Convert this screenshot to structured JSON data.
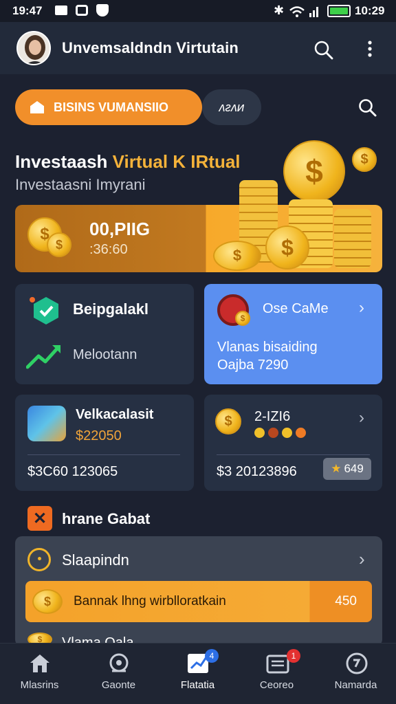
{
  "status_bar": {
    "time_left": "19:47",
    "time_right": "10:29"
  },
  "app_bar": {
    "title": "Unvemsaldndn Virtutain",
    "search_icon": "search-icon",
    "menu_icon": "more-vert-icon"
  },
  "chips": {
    "primary_label": "BISINS VUMANSIIO",
    "secondary_label": "ᴧᴤᴧᴎ"
  },
  "hero": {
    "title_white": "Investaash",
    "title_gold": "Virtual K IRtual",
    "subtitle": "Investaasni Imyrani"
  },
  "balance": {
    "amount": "00,PIIG",
    "sub": ":36:60"
  },
  "cards": {
    "top_left": {
      "title": "Beipgalakl",
      "subtitle": "Melootann"
    },
    "top_right": {
      "title": "Ose CaMe",
      "line1": "Vlanas bisaiding",
      "line2": "Oajba 7290"
    },
    "mid_left": {
      "title": "Velkacalasit",
      "price": "$22050",
      "footer": "$3C60 123065"
    },
    "mid_right": {
      "title": "2-IZI6",
      "footer": "$3 20123896",
      "rating": "649"
    }
  },
  "section": {
    "title": "hrane Gabat",
    "item_title": "Slaapindn",
    "promo_text": "Bannak lhng wirblloratkain",
    "promo_value": "450",
    "item2_title": "Vlama Oala"
  },
  "bottom_nav": [
    {
      "label": "Mlasrins",
      "icon": "home-icon"
    },
    {
      "label": "Gaonte",
      "icon": "search-icon"
    },
    {
      "label": "Flatatia",
      "icon": "chart-icon",
      "badge": "4"
    },
    {
      "label": "Ceoreo",
      "icon": "inbox-icon",
      "badge": "1"
    },
    {
      "label": "Namarda",
      "icon": "profile-icon"
    }
  ],
  "colors": {
    "accent_orange": "#f18f2a",
    "card_blue": "#5b8ff0",
    "background": "#1c2130",
    "gold": "#f0b41c"
  }
}
